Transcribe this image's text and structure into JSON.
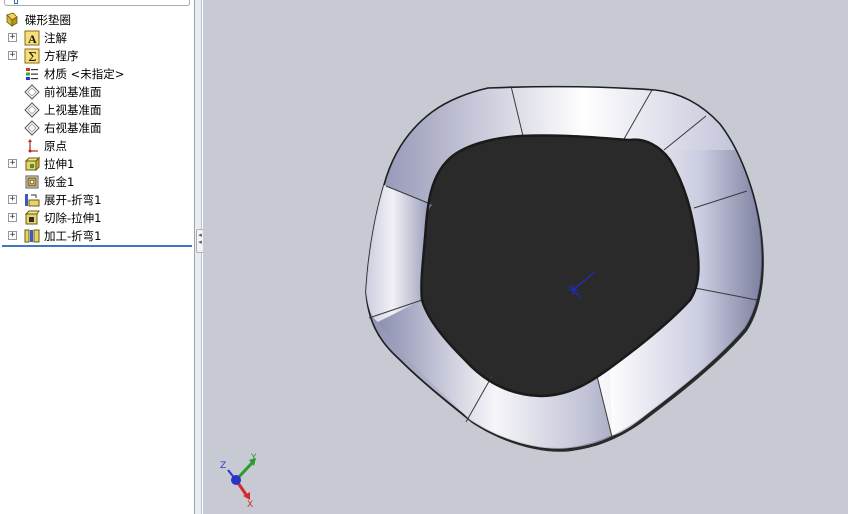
{
  "feature_tree": {
    "root": {
      "label": "碟形垫圈",
      "icon": "part-icon"
    },
    "items": [
      {
        "label": "注解",
        "icon": "annotations-icon",
        "expandable": true
      },
      {
        "label": "方程序",
        "icon": "equations-icon",
        "expandable": true
      },
      {
        "label": "材质 <未指定>",
        "icon": "material-icon",
        "expandable": false
      },
      {
        "label": "前视基准面",
        "icon": "plane-icon",
        "expandable": false
      },
      {
        "label": "上视基准面",
        "icon": "plane-icon",
        "expandable": false
      },
      {
        "label": "右视基准面",
        "icon": "plane-icon",
        "expandable": false
      },
      {
        "label": "原点",
        "icon": "origin-icon",
        "expandable": false
      },
      {
        "label": "拉伸1",
        "icon": "extrude-icon",
        "expandable": true
      },
      {
        "label": "钣金1",
        "icon": "sheet-metal-icon",
        "expandable": false
      },
      {
        "label": "展开-折弯1",
        "icon": "unfold-icon",
        "expandable": true
      },
      {
        "label": "切除-拉伸1",
        "icon": "cut-extrude-icon",
        "expandable": true
      },
      {
        "label": "加工-折弯1",
        "icon": "fold-icon",
        "expandable": true
      }
    ],
    "expander_symbol": "+"
  },
  "splitter": {
    "arrow": "◂"
  },
  "triad": {
    "x": "X",
    "y": "Y",
    "z": "Z"
  },
  "colors": {
    "viewport_bg": "#c7cad3",
    "rollback_bar": "#3d77c4",
    "triad_x": "#d42a2a",
    "triad_y": "#2a9a2a",
    "triad_z": "#2a35c8",
    "origin": "#1d2fb8"
  }
}
